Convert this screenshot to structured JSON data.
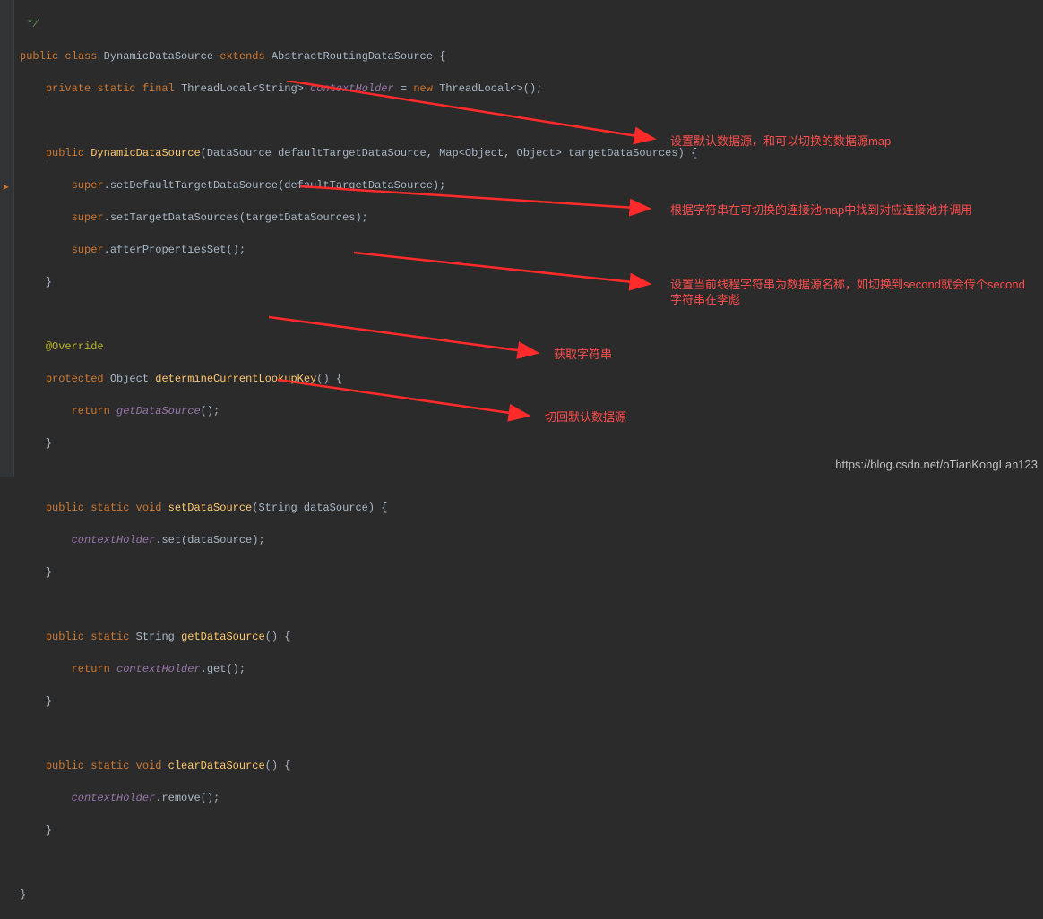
{
  "code": {
    "comment_end": " */",
    "class_decl_1": "public",
    "class_decl_2": "class",
    "class_name": "DynamicDataSource",
    "extends_kw": "extends",
    "superclass": "AbstractRoutingDataSource",
    "field_mods": "private static final",
    "field_type1": "ThreadLocal",
    "field_generic": "String",
    "field_name": "contextHolder",
    "new_kw": "new",
    "ctor_mod": "public",
    "ctor_name": "DynamicDataSource",
    "ctor_params": "(DataSource defaultTargetDataSource, Map<Object, Object> targetDataSources) {",
    "super_kw": "super",
    "setDefault": "setDefaultTargetDataSource",
    "setDefault_arg": "(defaultTargetDataSource);",
    "setTarget": "setTargetDataSources",
    "setTarget_arg": "(targetDataSources);",
    "afterProps": "afterPropertiesSet",
    "afterProps_arg": "();",
    "override": "@Override",
    "protected_kw": "protected",
    "object_type": "Object",
    "determine": "determineCurrentLookupKey",
    "return_kw": "return",
    "getDS_call": "getDataSource",
    "psv": "public static void",
    "ps": "public static",
    "string_type": "String",
    "setDS": "setDataSource",
    "setDS_params": "(String dataSource) {",
    "ctx": "contextHolder",
    "set_call": ".set(dataSource);",
    "getDS": "getDataSource",
    "get_call": ".get();",
    "clearDS": "clearDataSource",
    "remove_call": ".remove();"
  },
  "annotations": {
    "a1": "设置默认数据源，和可以切换的数据源map",
    "a2": "根据字符串在可切换的连接池map中找到对应连接池并调用",
    "a3": "设置当前线程字符串为数据源名称，如切换到second就会传个second字符串在李彪",
    "a4": "获取字符串",
    "a5": "切回默认数据源"
  },
  "watermark": "https://blog.csdn.net/oTianKongLan123"
}
